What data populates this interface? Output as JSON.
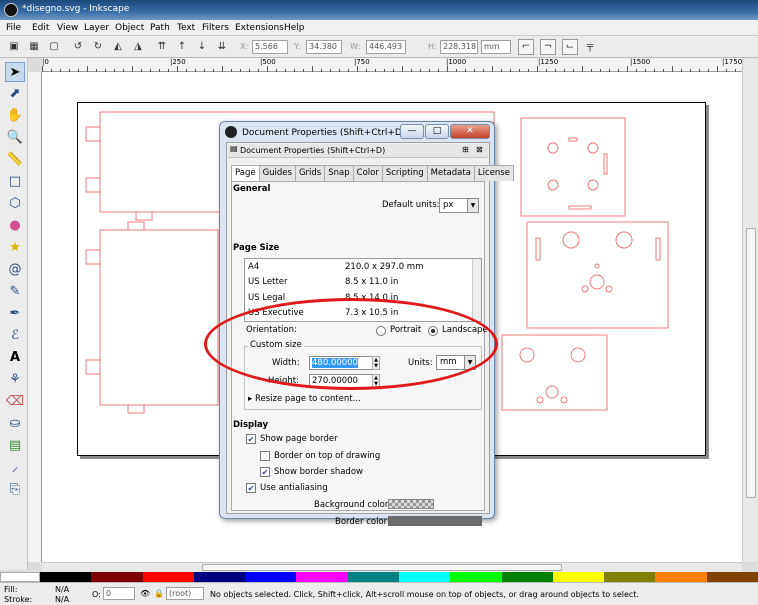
{
  "window": {
    "title": "*disegno.svg - Inkscape"
  },
  "menu": [
    "File",
    "Edit",
    "View",
    "Layer",
    "Object",
    "Path",
    "Text",
    "Filters",
    "Extensions",
    "Help"
  ],
  "toolbar": {
    "x_label": "X:",
    "x_value": "5.566",
    "y_label": "Y:",
    "y_value": "34.380",
    "w_label": "W:",
    "w_value": "446.493",
    "h_label": "H:",
    "h_value": "228.318",
    "unit": "mm"
  },
  "ruler": {
    "ticks": [
      "|0",
      "|250",
      "|500",
      "|750",
      "|1000",
      "|1250",
      "|1500",
      "|1750"
    ]
  },
  "dialog": {
    "title": "Document Properties (Shift+Ctrl+D)",
    "panel_title": "Document Properties (Shift+Ctrl+D)",
    "tabs": [
      "Page",
      "Guides",
      "Grids",
      "Snap",
      "Color",
      "Scripting",
      "Metadata",
      "License"
    ],
    "general": "General",
    "default_units_label": "Default units:",
    "default_units_value": "px",
    "page_size": "Page Size",
    "sizes": [
      {
        "name": "A4",
        "dims": "210.0 x 297.0 mm"
      },
      {
        "name": "US Letter",
        "dims": "8.5 x 11.0 in"
      },
      {
        "name": "US Legal",
        "dims": "8.5 x 14.0 in"
      },
      {
        "name": "US Executive",
        "dims": "7.3 x 10.5 in"
      }
    ],
    "orientation_label": "Orientation:",
    "portrait": "Portrait",
    "landscape": "Landscape",
    "custom_size": "Custom size",
    "width_label": "Width:",
    "width_value": "480.00000",
    "height_label": "Height:",
    "height_value": "270.00000",
    "units_label": "Units:",
    "units_value": "mm",
    "resize_label": "Resize page to content...",
    "display": "Display",
    "show_page_border": "Show page border",
    "border_on_top": "Border on top of drawing",
    "show_border_shadow": "Show border shadow",
    "use_antialiasing": "Use antialiasing",
    "background_color": "Background color:",
    "border_color": "Border color:"
  },
  "status": {
    "fill_label": "Fill:",
    "fill_value": "N/A",
    "stroke_label": "Stroke:",
    "stroke_value": "N/A",
    "opacity_label": "O:",
    "opacity_value": "0",
    "layer": "(root)",
    "message": "No objects selected. Click, Shift+click, Alt+scroll mouse on top of objects, or drag around objects to select."
  },
  "colors": {
    "accent": "#e0191b",
    "shape_stroke": "#f07a7a",
    "palette": [
      "#000000",
      "#7f0000",
      "#ff0000",
      "#000080",
      "#0000ff",
      "#ff00ff",
      "#008080",
      "#00ffff",
      "#00ff00",
      "#008000",
      "#ffff00",
      "#808000",
      "#ff8000",
      "#804000"
    ]
  }
}
